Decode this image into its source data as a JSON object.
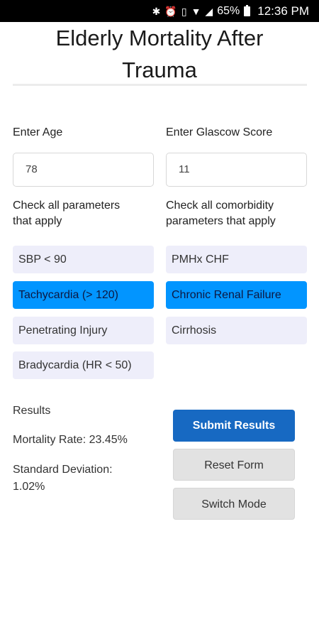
{
  "status_bar": {
    "icons": [
      "bluetooth-icon",
      "alarm-icon",
      "vibrate-icon",
      "wifi-icon",
      "signal-icon",
      "battery-icon"
    ],
    "battery": "65%",
    "time": "12:36 PM"
  },
  "app": {
    "title_line1": "Elderly Mortality After",
    "title_line2": "Trauma"
  },
  "form": {
    "age_label": "Enter Age",
    "age_value": "78",
    "glasgow_label": "Enter Glascow Score",
    "glasgow_value": "11",
    "params_label_line1": "Check all parameters",
    "params_label_line2": "that apply",
    "comorb_label_line1": "Check all comorbidity",
    "comorb_label_line2": "parameters that apply",
    "parameters": [
      {
        "label": "SBP < 90",
        "selected": false
      },
      {
        "label": "Tachycardia (> 120)",
        "selected": true
      },
      {
        "label": "Penetrating Injury",
        "selected": false
      },
      {
        "label": "Bradycardia (HR < 50)",
        "selected": false
      }
    ],
    "comorbidities": [
      {
        "label": "PMHx CHF",
        "selected": false
      },
      {
        "label": "Chronic Renal Failure",
        "selected": true
      },
      {
        "label": "Cirrhosis",
        "selected": false
      }
    ]
  },
  "results": {
    "heading": "Results",
    "mortality": "Mortality Rate: 23.45%",
    "std_line1": "Standard Deviation:",
    "std_line2": "1.02%"
  },
  "buttons": {
    "submit": "Submit Results",
    "reset": "Reset Form",
    "switch": "Switch Mode"
  },
  "colors": {
    "selected_option": "#0295ff",
    "unselected_option": "#eeeefa",
    "primary_button": "#1769c2",
    "secondary_button": "#e2e2e2"
  }
}
